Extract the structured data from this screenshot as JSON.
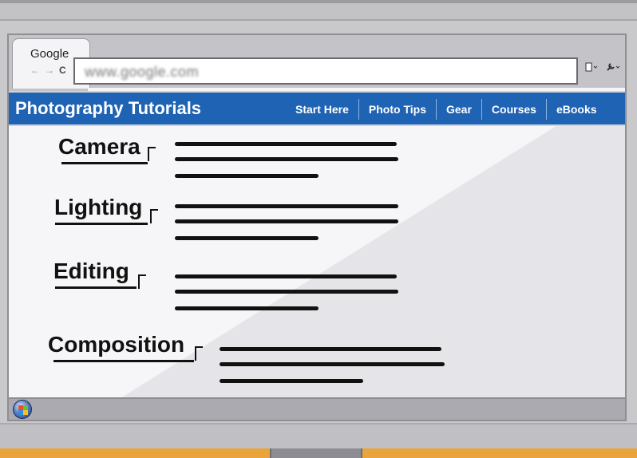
{
  "browser": {
    "tab_title": "Google",
    "nav": {
      "back": "←",
      "forward": "→",
      "refresh": "C"
    },
    "address": "www.google.com",
    "icons": [
      "page-icon",
      "wrench-icon"
    ]
  },
  "site": {
    "title": "Photography Tutorials",
    "nav": [
      {
        "label": "Start Here"
      },
      {
        "label": "Photo Tips"
      },
      {
        "label": "Gear"
      },
      {
        "label": "Courses"
      },
      {
        "label": "eBooks"
      }
    ]
  },
  "sections": [
    {
      "heading": "Camera"
    },
    {
      "heading": "Lighting"
    },
    {
      "heading": "Editing"
    },
    {
      "heading": "Composition"
    }
  ],
  "colors": {
    "header_blue": "#1e63b4",
    "floor_orange": "#e9a43a",
    "text": "#111111"
  }
}
